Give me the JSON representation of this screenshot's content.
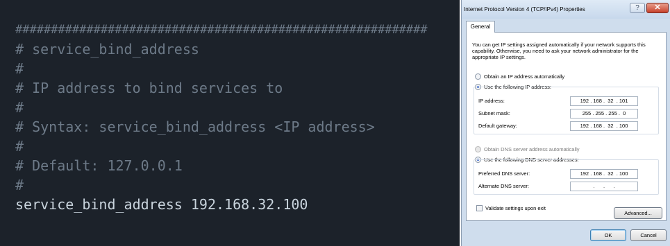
{
  "terminal": {
    "lines": [
      {
        "kind": "hashrow",
        "text": "##########################################################"
      },
      {
        "kind": "comment",
        "text": "# service_bind_address"
      },
      {
        "kind": "comment",
        "text": "#"
      },
      {
        "kind": "comment",
        "text": "# IP address to bind services to"
      },
      {
        "kind": "comment",
        "text": "#"
      },
      {
        "kind": "comment",
        "text": "# Syntax: service_bind_address <IP address>"
      },
      {
        "kind": "comment",
        "text": "#"
      },
      {
        "kind": "comment",
        "text": "# Default: 127.0.0.1"
      },
      {
        "kind": "comment",
        "text": "#"
      },
      {
        "kind": "config",
        "text": "service_bind_address 192.168.32.100"
      }
    ]
  },
  "dialog": {
    "title": "Internet Protocol Version 4 (TCP/IPv4) Properties",
    "help_label": "?",
    "close_label": "✕",
    "tab_general": "General",
    "intro": "You can get IP settings assigned automatically if your network supports this capability. Otherwise, you need to ask your network administrator for the appropriate IP settings.",
    "ip_auto": "Obtain an IP address automatically",
    "ip_manual": "Use the following IP address:",
    "ip_address_label": "IP address:",
    "ip_address_value": "192 . 168 .  32  . 101",
    "subnet_label": "Subnet mask:",
    "subnet_value": "255 . 255 . 255 .  0",
    "gateway_label": "Default gateway:",
    "gateway_value": "192 . 168 .  32  . 100",
    "dns_auto": "Obtain DNS server address automatically",
    "dns_manual": "Use the following DNS server addresses:",
    "preferred_dns_label": "Preferred DNS server:",
    "preferred_dns_value": "192 . 168 .  32  . 100",
    "alternate_dns_label": "Alternate DNS server:",
    "alternate_dns_value": "  .      .      .  ",
    "validate_label": "Validate settings upon exit",
    "advanced_label": "Advanced...",
    "ok_label": "OK",
    "cancel_label": "Cancel"
  }
}
